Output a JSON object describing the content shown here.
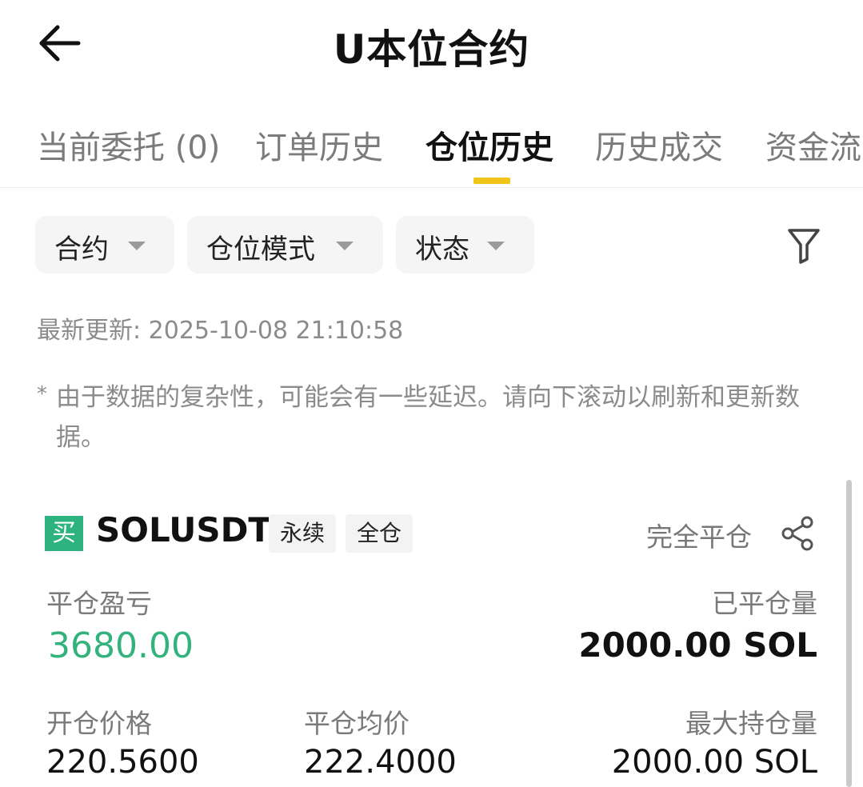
{
  "header": {
    "title": "U本位合约",
    "back_icon": "arrow-left-icon"
  },
  "tabs": [
    {
      "label": "当前委托 (0)",
      "active": false
    },
    {
      "label": "订单历史",
      "active": false
    },
    {
      "label": "仓位历史",
      "active": true
    },
    {
      "label": "历史成交",
      "active": false
    },
    {
      "label": "资金流",
      "active": false
    }
  ],
  "filters": [
    {
      "label": "合约"
    },
    {
      "label": "仓位模式"
    },
    {
      "label": "状态"
    }
  ],
  "update": {
    "text": "最新更新: 2025-10-08 21:10:58"
  },
  "note": {
    "star": "*",
    "text": "由于数据的复杂性，可能会有一些延迟。请向下滚动以刷新和更新数据。"
  },
  "position": {
    "side": "买",
    "symbol": "SOLUSDT",
    "tags": [
      "永续",
      "全仓"
    ],
    "status": "完全平仓",
    "pnl_label": "平仓盈亏",
    "pnl_value": "3680.00",
    "closed_qty_label": "已平仓量",
    "closed_qty_value": "2000.00 SOL",
    "entry_price_label": "开仓价格",
    "entry_price_value": "220.5600",
    "close_price_label": "平仓均价",
    "close_price_value": "222.4000",
    "max_pos_label": "最大持仓量",
    "max_pos_value": "2000.00 SOL"
  },
  "colors": {
    "accent": "#f0c419",
    "profit": "#33b27d",
    "buy_badge": "#2db37d"
  }
}
